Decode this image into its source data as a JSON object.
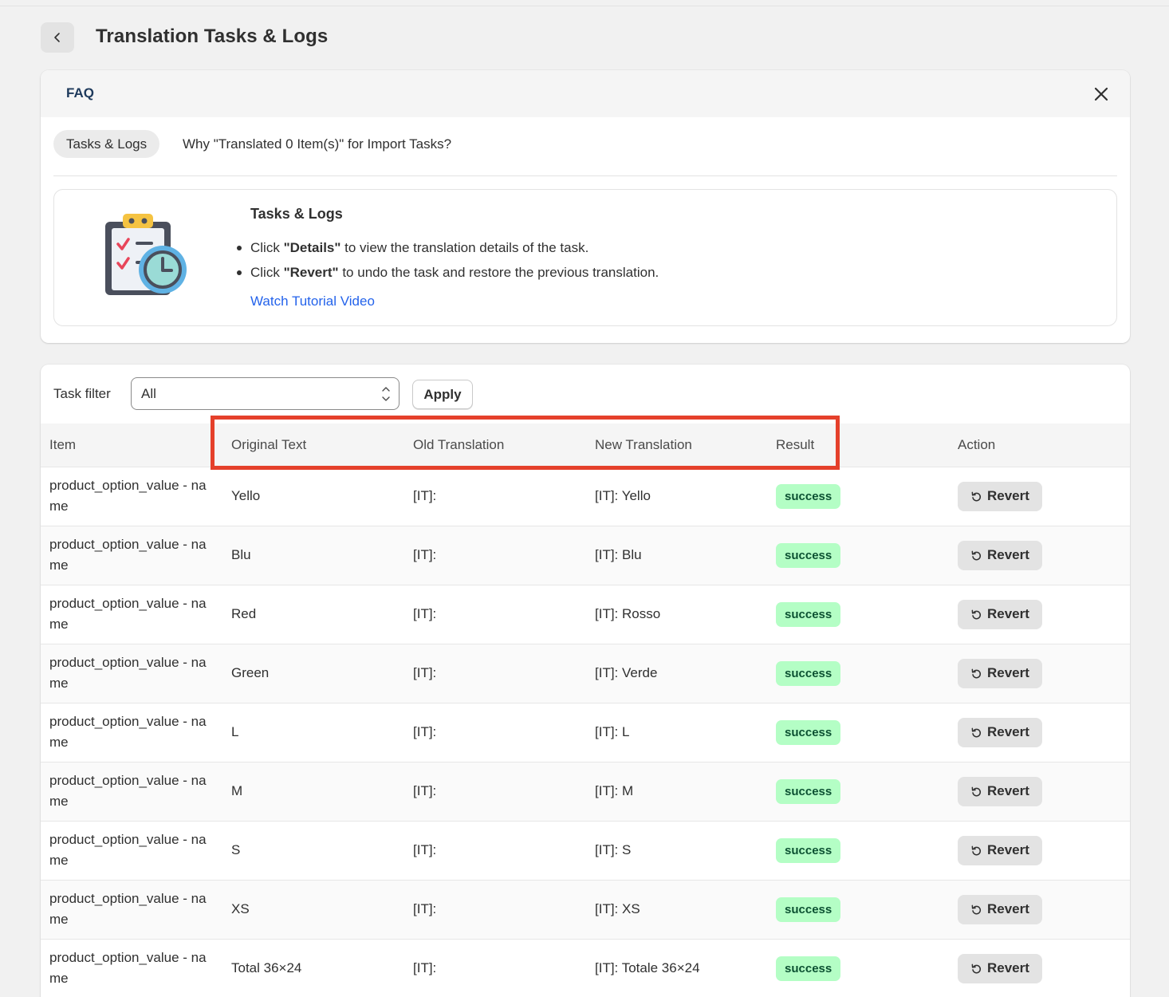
{
  "header": {
    "title": "Translation Tasks & Logs"
  },
  "faq": {
    "title": "FAQ",
    "tabs": [
      {
        "label": "Tasks & Logs"
      },
      {
        "label": "Why \"Translated 0 Item(s)\" for Import Tasks?"
      }
    ],
    "box": {
      "title": "Tasks & Logs",
      "items": [
        {
          "prefix": "Click ",
          "strong": "\"Details\"",
          "suffix": " to view the translation details of the task."
        },
        {
          "prefix": "Click ",
          "strong": "\"Revert\"",
          "suffix": " to undo the task and restore the previous translation."
        }
      ],
      "link": "Watch Tutorial Video"
    }
  },
  "filter": {
    "label": "Task filter",
    "selected": "All",
    "apply_label": "Apply"
  },
  "table": {
    "columns": [
      "Item",
      "Original Text",
      "Old Translation",
      "New Translation",
      "Result",
      "Action"
    ],
    "revert_label": "Revert",
    "rows": [
      {
        "item": "product_option_value - name",
        "original": "Yello",
        "old": "[IT]:",
        "new": "[IT]: Yello",
        "result": "success"
      },
      {
        "item": "product_option_value - name",
        "original": "Blu",
        "old": "[IT]:",
        "new": "[IT]: Blu",
        "result": "success"
      },
      {
        "item": "product_option_value - name",
        "original": "Red",
        "old": "[IT]:",
        "new": "[IT]: Rosso",
        "result": "success"
      },
      {
        "item": "product_option_value - name",
        "original": "Green",
        "old": "[IT]:",
        "new": "[IT]: Verde",
        "result": "success"
      },
      {
        "item": "product_option_value - name",
        "original": "L",
        "old": "[IT]:",
        "new": "[IT]: L",
        "result": "success"
      },
      {
        "item": "product_option_value - name",
        "original": "M",
        "old": "[IT]:",
        "new": "[IT]: M",
        "result": "success"
      },
      {
        "item": "product_option_value - name",
        "original": "S",
        "old": "[IT]:",
        "new": "[IT]: S",
        "result": "success"
      },
      {
        "item": "product_option_value - name",
        "original": "XS",
        "old": "[IT]:",
        "new": "[IT]: XS",
        "result": "success"
      },
      {
        "item": "product_option_value - name",
        "original": "Total 36×24",
        "old": "[IT]:",
        "new": "[IT]: Totale 36×24",
        "result": "success"
      }
    ]
  },
  "colors": {
    "success_badge_bg": "#b4fec5",
    "link": "#2463eb",
    "highlight": "#e5402b"
  }
}
